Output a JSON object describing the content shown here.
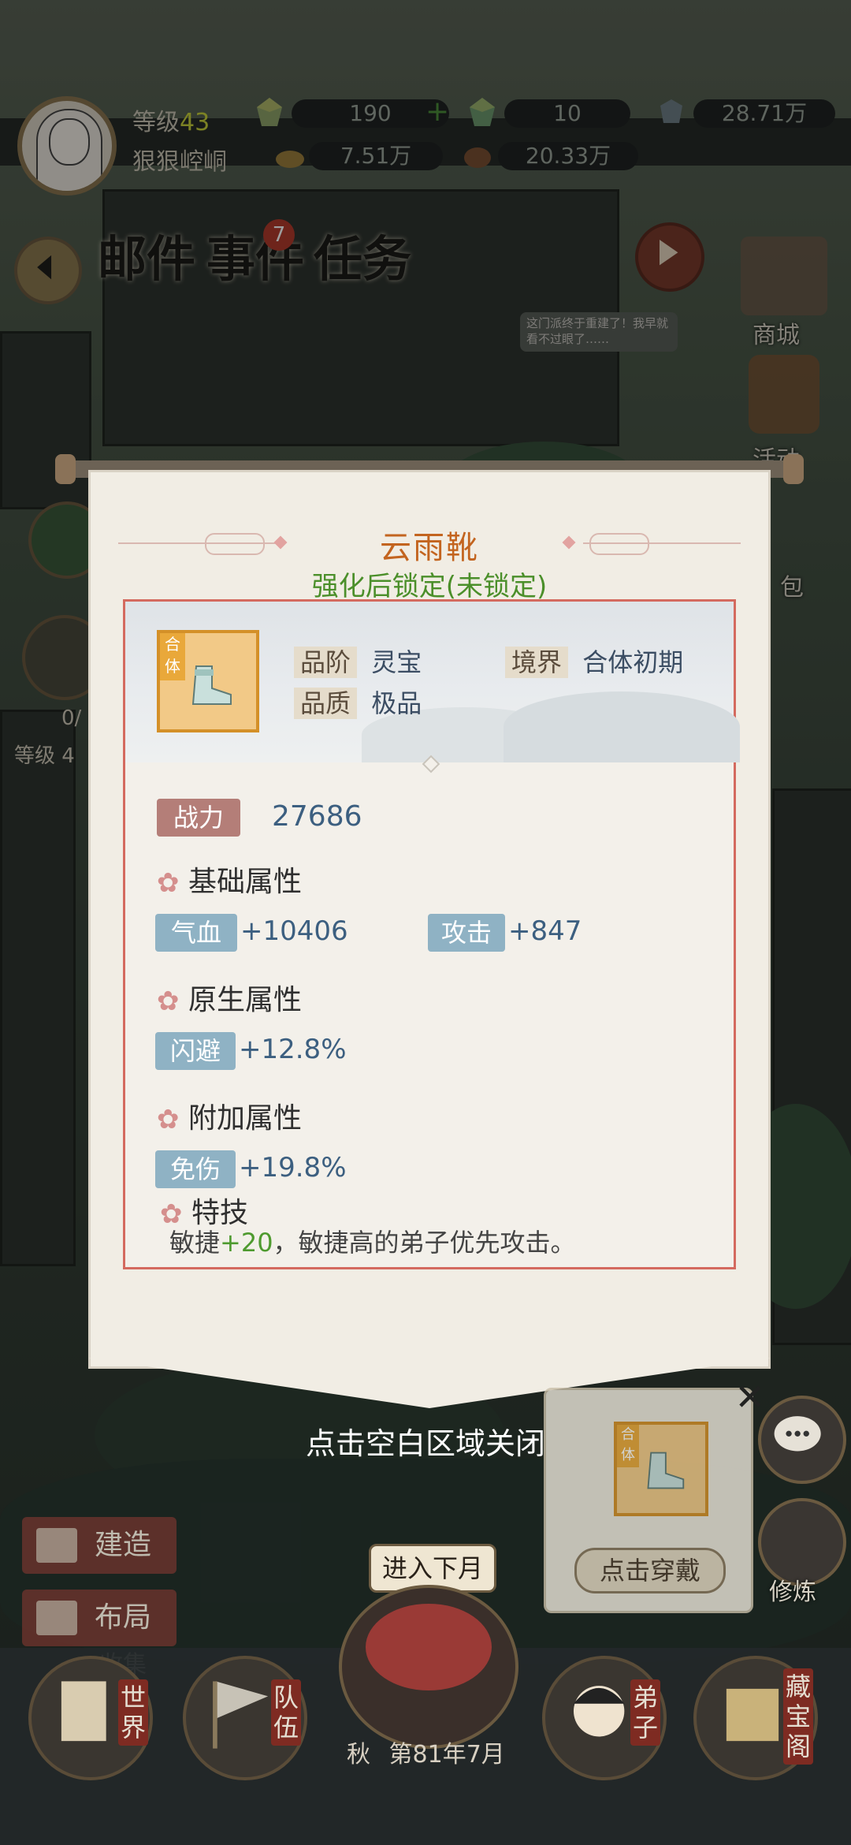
{
  "hud": {
    "level_label": "等级",
    "level_value": "43",
    "username": "狠狠崆峒",
    "resources": [
      "190",
      "10",
      "28.71万",
      "7.51万",
      "20.33万"
    ]
  },
  "top_buttons": {
    "mail": "邮件",
    "events": "事件",
    "events_badge": "7",
    "tasks": "任务"
  },
  "side_right": {
    "shop": "商城",
    "activity": "活动",
    "bag": "包",
    "cultivate": "修炼"
  },
  "left_hint": {
    "progress": "0/",
    "level": "等级 4"
  },
  "scene": {
    "speech": "这门派终于重建了！我早就看不过眼了……"
  },
  "item": {
    "name": "云雨靴",
    "lock_status": "强化后锁定(未锁定)",
    "realm_tag": "合体",
    "grade_label": "品阶",
    "grade_value": "灵宝",
    "quality_label": "品质",
    "quality_value": "极品",
    "realm_label": "境界",
    "realm_value": "合体初期",
    "power_label": "战力",
    "power_value": "27686",
    "sections": {
      "base": "基础属性",
      "native": "原生属性",
      "extra": "附加属性",
      "skill": "特技"
    },
    "base_attrs": [
      {
        "name": "气血",
        "value": "+10406"
      },
      {
        "name": "攻击",
        "value": "+847"
      }
    ],
    "native_attr": {
      "name": "闪避",
      "value": "+12.8%"
    },
    "extra_attr": {
      "name": "免伤",
      "value": "+19.8%"
    },
    "skill_prefix": "敏捷",
    "skill_bonus": "+20",
    "skill_suffix": "，敏捷高的弟子优先攻击。"
  },
  "close_hint": "点击空白区域关闭",
  "equip_widget": {
    "realm_tag": "合体",
    "button": "点击穿戴"
  },
  "bottom_left": {
    "build": "建造",
    "layout": "布局",
    "collect": "收集"
  },
  "bottom_nav": {
    "world": "世界",
    "team": "队伍",
    "disciples": "弟子",
    "treasure": "藏宝阁",
    "next_month": "进入下月",
    "season": "秋",
    "date": "第81年7月"
  },
  "colors": {
    "title": "#c3641f",
    "lock_green": "#4b8f2a",
    "card_border": "#d46a5f",
    "attr_tag": "#8fb2c4",
    "power_tag": "#b47e78"
  }
}
